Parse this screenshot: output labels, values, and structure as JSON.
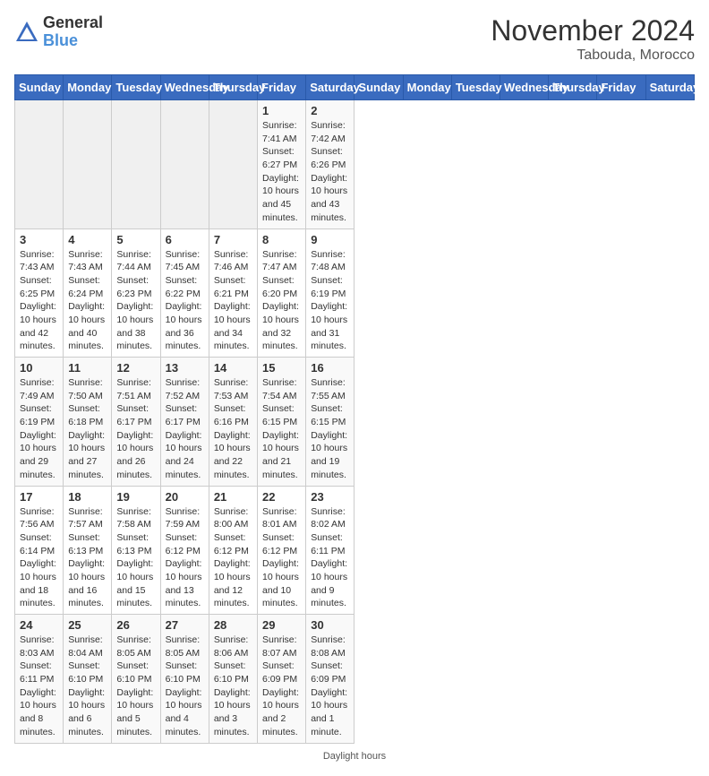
{
  "logo": {
    "text_general": "General",
    "text_blue": "Blue"
  },
  "title": {
    "month": "November 2024",
    "location": "Tabouda, Morocco"
  },
  "headers": [
    "Sunday",
    "Monday",
    "Tuesday",
    "Wednesday",
    "Thursday",
    "Friday",
    "Saturday"
  ],
  "weeks": [
    [
      {
        "day": "",
        "sunrise": "",
        "sunset": "",
        "daylight": ""
      },
      {
        "day": "",
        "sunrise": "",
        "sunset": "",
        "daylight": ""
      },
      {
        "day": "",
        "sunrise": "",
        "sunset": "",
        "daylight": ""
      },
      {
        "day": "",
        "sunrise": "",
        "sunset": "",
        "daylight": ""
      },
      {
        "day": "",
        "sunrise": "",
        "sunset": "",
        "daylight": ""
      },
      {
        "day": "1",
        "sunrise": "Sunrise: 7:41 AM",
        "sunset": "Sunset: 6:27 PM",
        "daylight": "Daylight: 10 hours and 45 minutes."
      },
      {
        "day": "2",
        "sunrise": "Sunrise: 7:42 AM",
        "sunset": "Sunset: 6:26 PM",
        "daylight": "Daylight: 10 hours and 43 minutes."
      }
    ],
    [
      {
        "day": "3",
        "sunrise": "Sunrise: 7:43 AM",
        "sunset": "Sunset: 6:25 PM",
        "daylight": "Daylight: 10 hours and 42 minutes."
      },
      {
        "day": "4",
        "sunrise": "Sunrise: 7:43 AM",
        "sunset": "Sunset: 6:24 PM",
        "daylight": "Daylight: 10 hours and 40 minutes."
      },
      {
        "day": "5",
        "sunrise": "Sunrise: 7:44 AM",
        "sunset": "Sunset: 6:23 PM",
        "daylight": "Daylight: 10 hours and 38 minutes."
      },
      {
        "day": "6",
        "sunrise": "Sunrise: 7:45 AM",
        "sunset": "Sunset: 6:22 PM",
        "daylight": "Daylight: 10 hours and 36 minutes."
      },
      {
        "day": "7",
        "sunrise": "Sunrise: 7:46 AM",
        "sunset": "Sunset: 6:21 PM",
        "daylight": "Daylight: 10 hours and 34 minutes."
      },
      {
        "day": "8",
        "sunrise": "Sunrise: 7:47 AM",
        "sunset": "Sunset: 6:20 PM",
        "daylight": "Daylight: 10 hours and 32 minutes."
      },
      {
        "day": "9",
        "sunrise": "Sunrise: 7:48 AM",
        "sunset": "Sunset: 6:19 PM",
        "daylight": "Daylight: 10 hours and 31 minutes."
      }
    ],
    [
      {
        "day": "10",
        "sunrise": "Sunrise: 7:49 AM",
        "sunset": "Sunset: 6:19 PM",
        "daylight": "Daylight: 10 hours and 29 minutes."
      },
      {
        "day": "11",
        "sunrise": "Sunrise: 7:50 AM",
        "sunset": "Sunset: 6:18 PM",
        "daylight": "Daylight: 10 hours and 27 minutes."
      },
      {
        "day": "12",
        "sunrise": "Sunrise: 7:51 AM",
        "sunset": "Sunset: 6:17 PM",
        "daylight": "Daylight: 10 hours and 26 minutes."
      },
      {
        "day": "13",
        "sunrise": "Sunrise: 7:52 AM",
        "sunset": "Sunset: 6:17 PM",
        "daylight": "Daylight: 10 hours and 24 minutes."
      },
      {
        "day": "14",
        "sunrise": "Sunrise: 7:53 AM",
        "sunset": "Sunset: 6:16 PM",
        "daylight": "Daylight: 10 hours and 22 minutes."
      },
      {
        "day": "15",
        "sunrise": "Sunrise: 7:54 AM",
        "sunset": "Sunset: 6:15 PM",
        "daylight": "Daylight: 10 hours and 21 minutes."
      },
      {
        "day": "16",
        "sunrise": "Sunrise: 7:55 AM",
        "sunset": "Sunset: 6:15 PM",
        "daylight": "Daylight: 10 hours and 19 minutes."
      }
    ],
    [
      {
        "day": "17",
        "sunrise": "Sunrise: 7:56 AM",
        "sunset": "Sunset: 6:14 PM",
        "daylight": "Daylight: 10 hours and 18 minutes."
      },
      {
        "day": "18",
        "sunrise": "Sunrise: 7:57 AM",
        "sunset": "Sunset: 6:13 PM",
        "daylight": "Daylight: 10 hours and 16 minutes."
      },
      {
        "day": "19",
        "sunrise": "Sunrise: 7:58 AM",
        "sunset": "Sunset: 6:13 PM",
        "daylight": "Daylight: 10 hours and 15 minutes."
      },
      {
        "day": "20",
        "sunrise": "Sunrise: 7:59 AM",
        "sunset": "Sunset: 6:12 PM",
        "daylight": "Daylight: 10 hours and 13 minutes."
      },
      {
        "day": "21",
        "sunrise": "Sunrise: 8:00 AM",
        "sunset": "Sunset: 6:12 PM",
        "daylight": "Daylight: 10 hours and 12 minutes."
      },
      {
        "day": "22",
        "sunrise": "Sunrise: 8:01 AM",
        "sunset": "Sunset: 6:12 PM",
        "daylight": "Daylight: 10 hours and 10 minutes."
      },
      {
        "day": "23",
        "sunrise": "Sunrise: 8:02 AM",
        "sunset": "Sunset: 6:11 PM",
        "daylight": "Daylight: 10 hours and 9 minutes."
      }
    ],
    [
      {
        "day": "24",
        "sunrise": "Sunrise: 8:03 AM",
        "sunset": "Sunset: 6:11 PM",
        "daylight": "Daylight: 10 hours and 8 minutes."
      },
      {
        "day": "25",
        "sunrise": "Sunrise: 8:04 AM",
        "sunset": "Sunset: 6:10 PM",
        "daylight": "Daylight: 10 hours and 6 minutes."
      },
      {
        "day": "26",
        "sunrise": "Sunrise: 8:05 AM",
        "sunset": "Sunset: 6:10 PM",
        "daylight": "Daylight: 10 hours and 5 minutes."
      },
      {
        "day": "27",
        "sunrise": "Sunrise: 8:05 AM",
        "sunset": "Sunset: 6:10 PM",
        "daylight": "Daylight: 10 hours and 4 minutes."
      },
      {
        "day": "28",
        "sunrise": "Sunrise: 8:06 AM",
        "sunset": "Sunset: 6:10 PM",
        "daylight": "Daylight: 10 hours and 3 minutes."
      },
      {
        "day": "29",
        "sunrise": "Sunrise: 8:07 AM",
        "sunset": "Sunset: 6:09 PM",
        "daylight": "Daylight: 10 hours and 2 minutes."
      },
      {
        "day": "30",
        "sunrise": "Sunrise: 8:08 AM",
        "sunset": "Sunset: 6:09 PM",
        "daylight": "Daylight: 10 hours and 1 minute."
      }
    ]
  ],
  "footer": "Daylight hours"
}
